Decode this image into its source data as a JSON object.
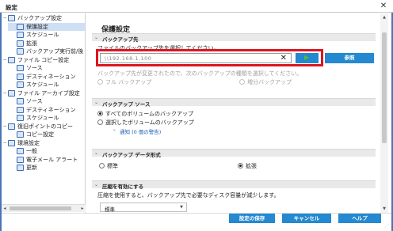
{
  "window": {
    "title": "設定",
    "close_glyph": "✕"
  },
  "tree": {
    "items": [
      {
        "label": "バックアップ設定",
        "expander": "−",
        "level": 0
      },
      {
        "label": "保護設定",
        "level": 1,
        "selected": true
      },
      {
        "label": "スケジュール",
        "level": 1
      },
      {
        "label": "拡張",
        "level": 1
      },
      {
        "label": "バックアップ実行前/後",
        "level": 1
      },
      {
        "label": "ファイル コピー設定",
        "expander": "−",
        "level": 0
      },
      {
        "label": "ソース",
        "level": 1
      },
      {
        "label": "デスティネーション",
        "level": 1
      },
      {
        "label": "スケジュール",
        "level": 1
      },
      {
        "label": "ファイル アーカイブ設定",
        "expander": "−",
        "level": 0
      },
      {
        "label": "ソース",
        "level": 1
      },
      {
        "label": "デスティネーション",
        "level": 1
      },
      {
        "label": "スケジュール",
        "level": 1
      },
      {
        "label": "復旧ポイントのコピー",
        "expander": "−",
        "level": 0
      },
      {
        "label": "コピー設定",
        "level": 1
      },
      {
        "label": "環境設定",
        "expander": "−",
        "level": 0
      },
      {
        "label": "一般",
        "level": 1
      },
      {
        "label": "電子メール アラート",
        "level": 1
      },
      {
        "label": "更新",
        "level": 1
      }
    ],
    "scroll_left": "◂",
    "scroll_right": "▸"
  },
  "main": {
    "title": "保護設定",
    "destination": {
      "header": "バックアップ先",
      "instruction": "ファイルのバックアップ先を選択してください。",
      "path_value": "\\\\192.168.1.100",
      "clear_glyph": "✕",
      "browse_label": "参照",
      "arrow_glyph": "▶",
      "change_note": "バックアップ先が変更されたので、次のバックアップの種類を選択してください。",
      "option_full": "フル バックアップ",
      "option_incremental": "増分バックアップ"
    },
    "source": {
      "header": "バックアップ ソース",
      "option_all": "すべてのボリュームのバックアップ",
      "option_selected": "選択したボリュームのバックアップ",
      "notice_link": "通知 (0 個の警告)"
    },
    "data_format": {
      "header": "バックアップ データ形式",
      "option_standard": "標準",
      "option_advanced": "拡張"
    },
    "compression": {
      "header": "圧縮を有効にする",
      "description": "圧縮を使用すると、バックアップ先で必要なディスク容量が減少します。",
      "selected": "標準",
      "dropdown_glyph": "▼"
    },
    "section_chevron": "⌄"
  },
  "footer": {
    "save_label": "設定の保存",
    "cancel_label": "キャンセル",
    "help_label": "ヘルプ",
    "grip_glyph": "⋰"
  },
  "colors": {
    "accent": "#2489d0",
    "highlight": "#e0141e",
    "frame": "#4a74b8"
  }
}
